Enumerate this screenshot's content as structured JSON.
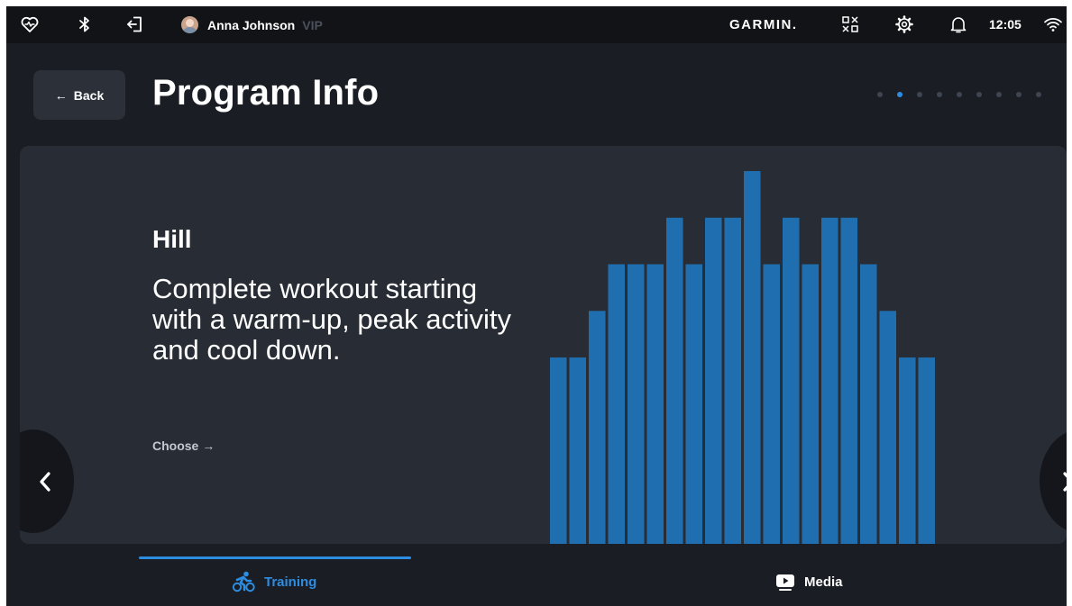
{
  "status_bar": {
    "icons": [
      "heart-pulse-icon",
      "bluetooth-icon",
      "logout-icon"
    ],
    "user_name": "Anna Johnson",
    "user_badge": "VIP",
    "brand": "GARMIN.",
    "right_icons": [
      "qr-code-icon",
      "gear-icon",
      "bell-icon",
      "wifi-icon"
    ],
    "time": "12:05"
  },
  "header": {
    "back_label": "Back",
    "title": "Program Info",
    "pager": {
      "count": 9,
      "active_index": 1
    }
  },
  "program": {
    "name": "Hill",
    "description": "Complete workout starting with a warm-up, peak activity and cool down.",
    "choose_label": "Choose",
    "chart_color": "#1f6fb0"
  },
  "chart_data": {
    "type": "bar",
    "title": "",
    "xlabel": "",
    "ylabel": "",
    "ylim": [
      0,
      8
    ],
    "values": [
      4,
      4,
      5,
      6,
      6,
      6,
      7,
      6,
      7,
      7,
      8,
      6,
      7,
      6,
      7,
      7,
      6,
      5,
      4,
      4
    ]
  },
  "bottom_nav": {
    "tabs": [
      {
        "label": "Training",
        "icon": "cycling-icon",
        "active": true
      },
      {
        "label": "Media",
        "icon": "play-icon",
        "active": false
      }
    ],
    "accent": "#2d8de0"
  }
}
